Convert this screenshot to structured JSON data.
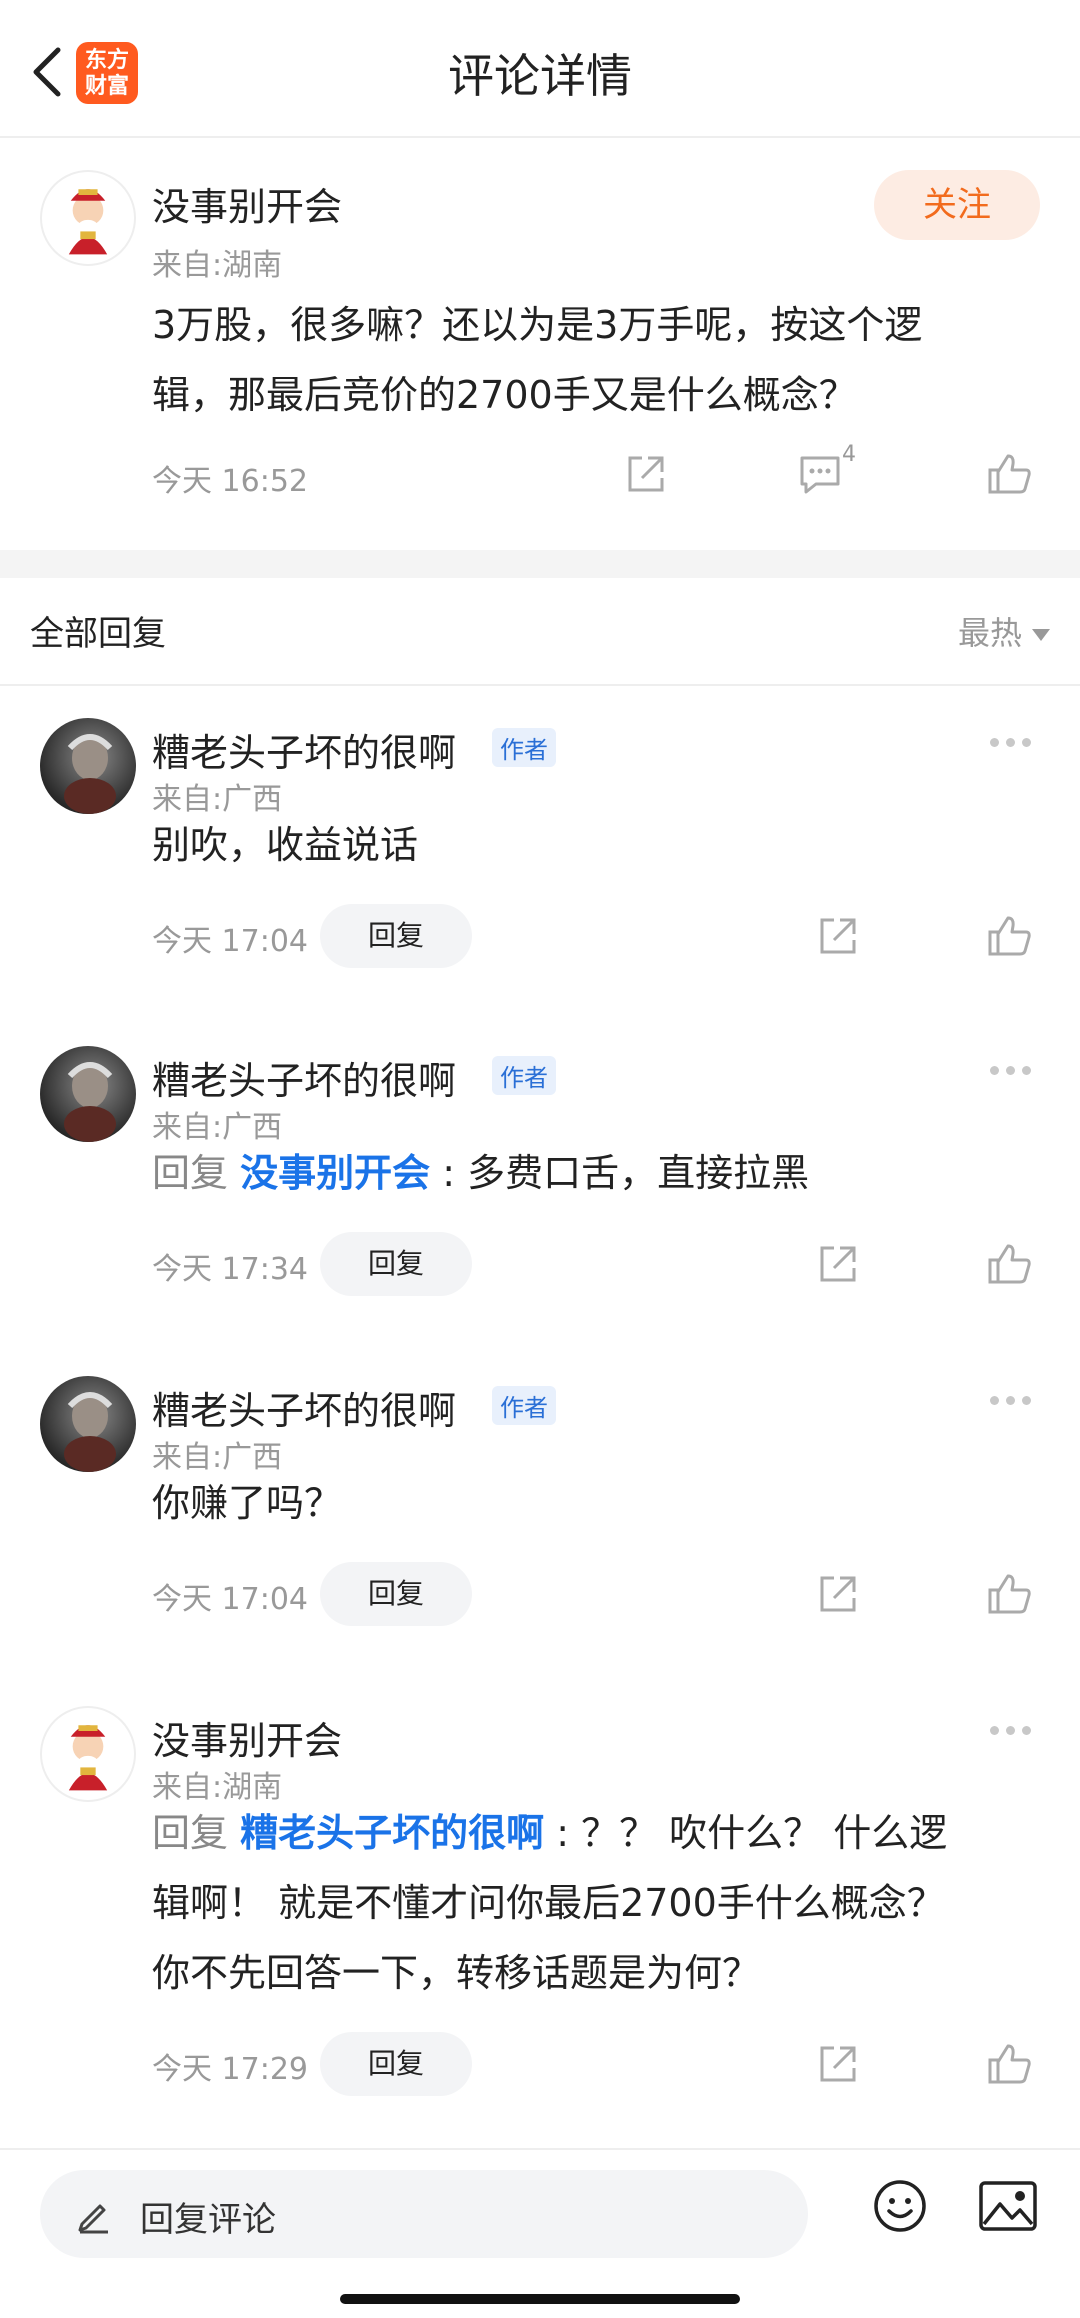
{
  "header": {
    "title": "评论详情",
    "logo_line1": "东方",
    "logo_line2": "财富"
  },
  "main_comment": {
    "username": "没事别开会",
    "location": "来自:湖南",
    "follow_label": "关注",
    "text_line1": "3万股，很多嘛？还以为是3万手呢，按这个逻",
    "text_line2": "辑，那最后竞价的2700手又是什么概念？",
    "time": "今天 16:52",
    "comment_count": "4"
  },
  "replies_section": {
    "title": "全部回复",
    "sort_label": "最热"
  },
  "replies": [
    {
      "username": "糟老头子坏的很啊",
      "tag": "作者",
      "location": "来自:广西",
      "text": "别吹，收益说话",
      "time": "今天 17:04",
      "reply_label": "回复"
    },
    {
      "username": "糟老头子坏的很啊",
      "tag": "作者",
      "location": "来自:广西",
      "reply_prefix": "回复 ",
      "mention": "没事别开会",
      "text": " : 多费口舌，直接拉黑",
      "time": "今天 17:34",
      "reply_label": "回复"
    },
    {
      "username": "糟老头子坏的很啊",
      "tag": "作者",
      "location": "来自:广西",
      "text": "你赚了吗？",
      "time": "今天 17:04",
      "reply_label": "回复"
    },
    {
      "username": "没事别开会",
      "location": "来自:湖南",
      "reply_prefix": "回复 ",
      "mention": "糟老头子坏的很啊",
      "text_line1": " : ？？   吹什么？  什么逻",
      "text_line2": "辑啊！  就是不懂才问你最后2700手什么概念？",
      "text_line3": "你不先回答一下，转移话题是为何？",
      "time": "今天 17:29",
      "reply_label": "回复"
    }
  ],
  "bottom_bar": {
    "placeholder": "回复评论"
  },
  "colors": {
    "accent": "#f26b1d",
    "mention": "#1a73e8",
    "author_tag": "#2a6fd6"
  }
}
